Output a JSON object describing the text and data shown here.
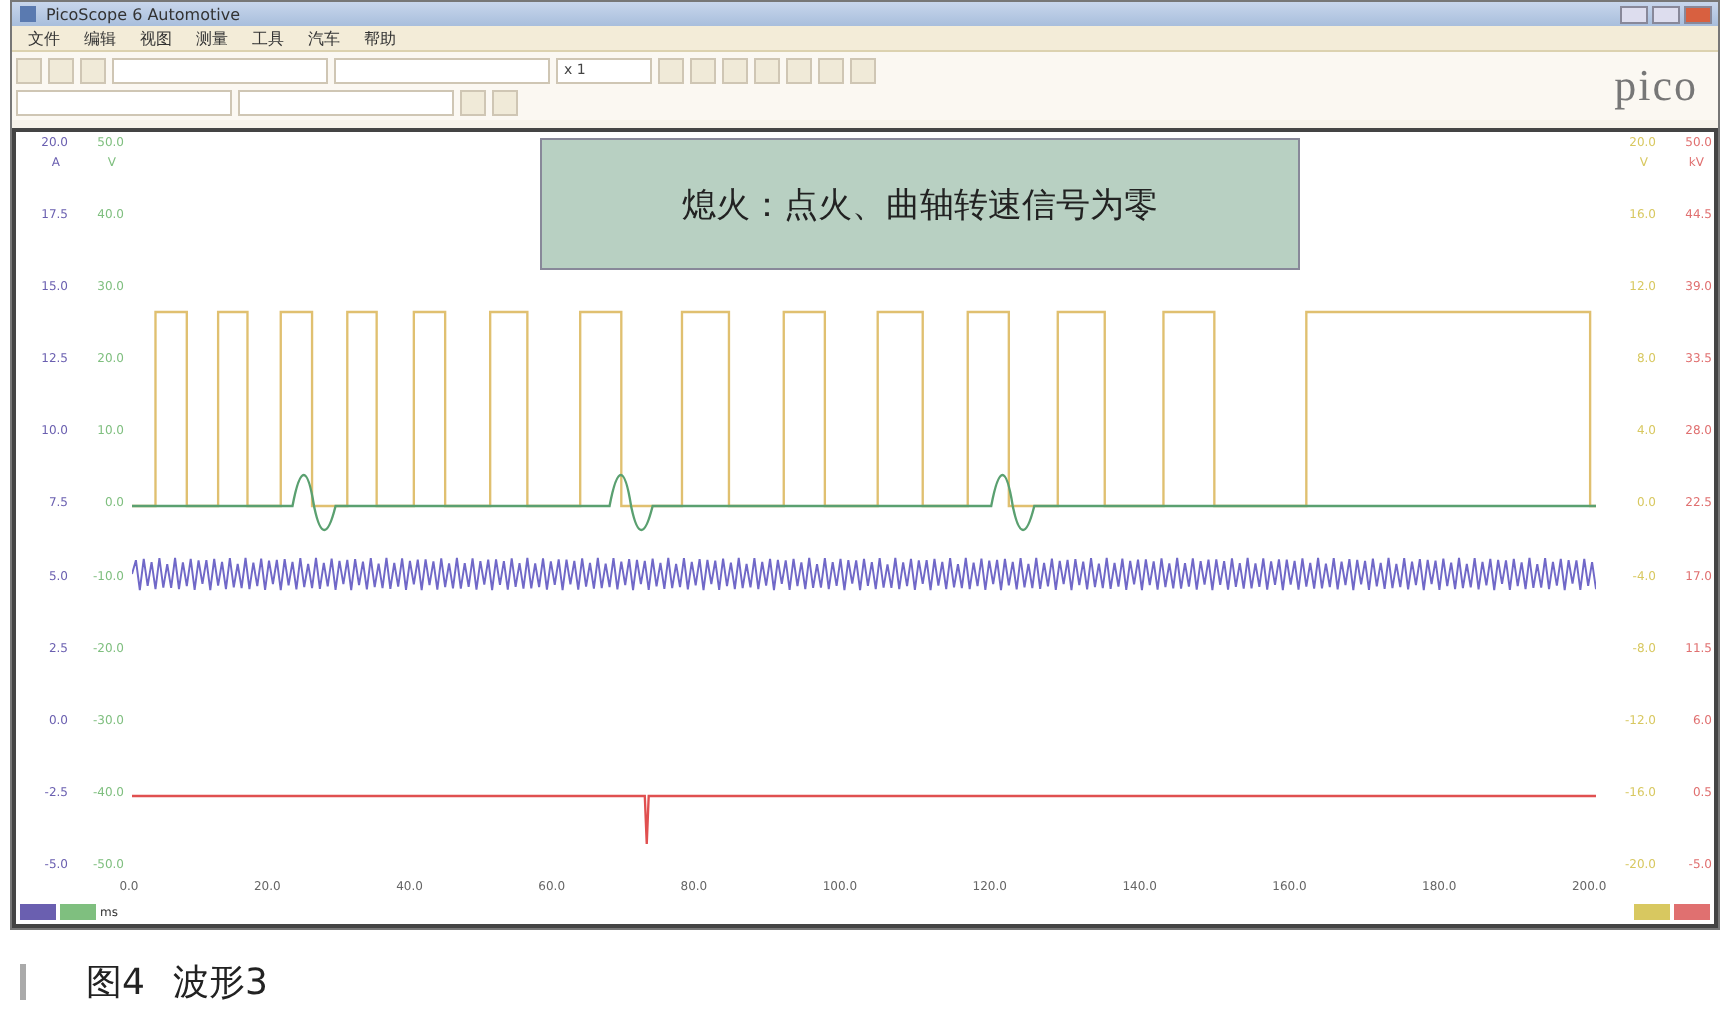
{
  "window": {
    "title": "PicoScope 6 Automotive"
  },
  "menu": [
    "文件",
    "编辑",
    "视图",
    "测量",
    "工具",
    "汽车",
    "帮助"
  ],
  "toolbar": {
    "zoom_field": "x 1"
  },
  "logo": {
    "text": "pico"
  },
  "plot": {
    "banner": "熄火：点火、曲轴转速信号为零",
    "left_axes": [
      {
        "unit": "A",
        "color": "#6a5fb0",
        "ticks": [
          "20.0",
          "17.5",
          "15.0",
          "12.5",
          "10.0",
          "7.5",
          "5.0",
          "2.5",
          "0.0",
          "-2.5",
          "-5.0"
        ]
      },
      {
        "unit": "V",
        "color": "#7fbf7f",
        "ticks": [
          "50.0",
          "40.0",
          "30.0",
          "20.0",
          "10.0",
          "0.0",
          "-10.0",
          "-20.0",
          "-30.0",
          "-40.0",
          "-50.0"
        ]
      }
    ],
    "right_axes": [
      {
        "unit": "V",
        "color": "#d8c860",
        "ticks": [
          "20.0",
          "16.0",
          "12.0",
          "8.0",
          "4.0",
          "0.0",
          "-4.0",
          "-8.0",
          "-12.0",
          "-16.0",
          "-20.0"
        ]
      },
      {
        "unit": "kV",
        "color": "#e07070",
        "ticks": [
          "50.0",
          "44.5",
          "39.0",
          "33.5",
          "28.0",
          "22.5",
          "17.0",
          "11.5",
          "6.0",
          "0.5",
          "-5.0"
        ]
      }
    ],
    "x_axis": {
      "unit": "ms",
      "ticks": [
        "0.0",
        "20.0",
        "40.0",
        "60.0",
        "80.0",
        "100.0",
        "120.0",
        "140.0",
        "160.0",
        "180.0",
        "200.0"
      ]
    }
  },
  "caption": {
    "figure": "图4",
    "title": "波形3"
  }
}
